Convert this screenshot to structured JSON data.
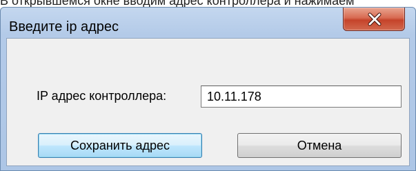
{
  "background_text": "В открывшемся окне вводим адрес контроллера и нажимаем",
  "dialog": {
    "title": "Введите ip адрес",
    "close_icon": "close-icon"
  },
  "form": {
    "ip_label": "IP адрес контроллера:",
    "ip_value": "10.11.178"
  },
  "buttons": {
    "save_label": "Сохранить адрес",
    "cancel_label": "Отмена"
  },
  "colors": {
    "close_button": "#c5432a",
    "default_button_border": "#3c7fb1",
    "client_background": "#f0f0f0"
  }
}
